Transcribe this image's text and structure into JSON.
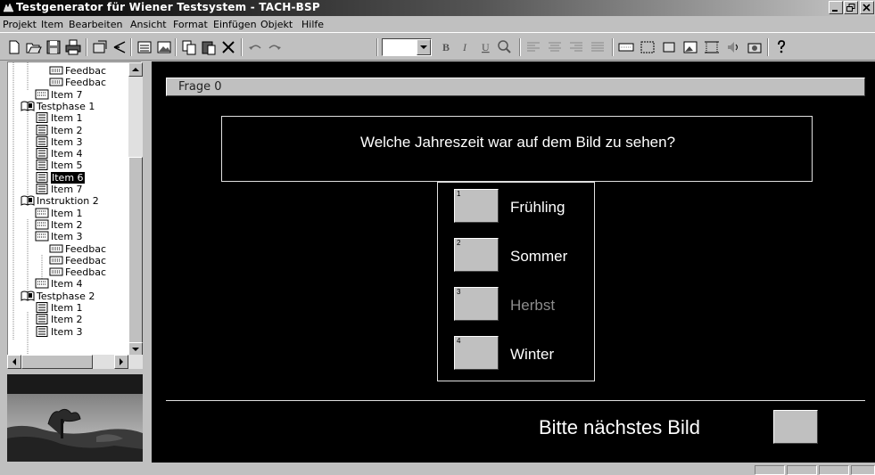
{
  "window": {
    "title": "Testgenerator für Wiener Testsystem - TACH-BSP"
  },
  "menu": [
    "Projekt",
    "Item",
    "Bearbeiten",
    "Ansicht",
    "Format",
    "Einfügen",
    "Objekt",
    "Hilfe"
  ],
  "toolbar": {
    "icons": [
      "new-icon",
      "open-icon",
      "save-icon",
      "print-icon",
      "properties-icon",
      "pointer-icon",
      "list-icon",
      "image-icon",
      "copy-icon",
      "paste-icon",
      "delete-icon",
      "undo-icon",
      "redo-icon",
      "bold-icon",
      "italic-icon",
      "underline-icon",
      "zoom-icon",
      "align-left-icon",
      "align-center-icon",
      "align-right-icon",
      "justify-icon",
      "textfield-icon",
      "frame-icon",
      "button-icon",
      "picture-icon",
      "object-icon",
      "sound-icon",
      "video-icon",
      "help-icon"
    ],
    "format_letters": [
      "B",
      "I",
      "U"
    ]
  },
  "tree": [
    {
      "label": "Feedbac",
      "type": "feedback"
    },
    {
      "label": "Feedbac",
      "type": "feedback"
    },
    {
      "label": "Item 7",
      "type": "item"
    },
    {
      "label": "Testphase 1",
      "type": "book"
    },
    {
      "label": "Item 1",
      "type": "list"
    },
    {
      "label": "Item 2",
      "type": "list"
    },
    {
      "label": "Item 3",
      "type": "list"
    },
    {
      "label": "Item 4",
      "type": "list"
    },
    {
      "label": "Item 5",
      "type": "list"
    },
    {
      "label": "Item 6",
      "type": "list",
      "selected": true
    },
    {
      "label": "Item 7",
      "type": "list"
    },
    {
      "label": "Instruktion 2",
      "type": "book"
    },
    {
      "label": "Item 1",
      "type": "item"
    },
    {
      "label": "Item 2",
      "type": "item"
    },
    {
      "label": "Item 3",
      "type": "item"
    },
    {
      "label": "Feedbac",
      "type": "feedback"
    },
    {
      "label": "Feedbac",
      "type": "feedback"
    },
    {
      "label": "Feedbac",
      "type": "feedback"
    },
    {
      "label": "Item 4",
      "type": "item"
    },
    {
      "label": "Testphase 2",
      "type": "book"
    },
    {
      "label": "Item 1",
      "type": "list"
    },
    {
      "label": "Item 2",
      "type": "list"
    },
    {
      "label": "Item 3",
      "type": "list"
    }
  ],
  "editor": {
    "frame_title": "Frage 0",
    "question": "Welche Jahreszeit war auf dem Bild zu sehen?",
    "answers": [
      {
        "num": "1",
        "label": "Frühling",
        "dim": false
      },
      {
        "num": "2",
        "label": "Sommer",
        "dim": false
      },
      {
        "num": "3",
        "label": "Herbst",
        "dim": true
      },
      {
        "num": "4",
        "label": "Winter",
        "dim": false
      }
    ],
    "next_label": "Bitte nächstes Bild"
  },
  "colors": {
    "canvas": "#000000",
    "chrome": "#c0c0c0",
    "dim_text": "#8c8c8c",
    "selection": "#000000"
  }
}
